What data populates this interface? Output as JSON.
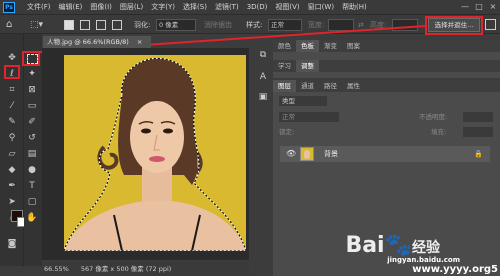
{
  "menubar": {
    "logo": "Ps",
    "items": [
      "文件(F)",
      "编辑(E)",
      "图像(I)",
      "图层(L)",
      "文字(Y)",
      "选择(S)",
      "滤镜(T)",
      "3D(D)",
      "视图(V)",
      "窗口(W)",
      "帮助(H)"
    ],
    "window_controls": [
      "—",
      "□",
      "×"
    ]
  },
  "options": {
    "feather_label": "羽化:",
    "feather_value": "0 像素",
    "antialias_label": "消除锯齿",
    "style_label": "样式:",
    "style_value": "正常",
    "width_label": "宽度:",
    "height_label": "高度:",
    "select_mask_label": "选择并遮住..."
  },
  "document": {
    "tab_title": "人物.jpg @ 66.6%(RGB/8)",
    "close": "×",
    "zoom": "66.55%",
    "size": "567 像素 x 500 像素 (72 ppi)"
  },
  "panels": {
    "top_tabs": [
      "颜色",
      "色板",
      "渐变",
      "图案"
    ],
    "mid_tabs": [
      "学习",
      "调整"
    ],
    "layer_tabs": [
      "图层",
      "通道",
      "路径",
      "属性"
    ],
    "kind_label": "类型",
    "blend_mode": "正常",
    "opacity_label": "不透明度:",
    "lock_label": "锁定:",
    "fill_label": "填充:"
  },
  "layers": [
    {
      "name": "背景"
    }
  ],
  "watermark": {
    "line1": "Bai",
    "line2": "经验",
    "line3": "jingyan.baidu.com",
    "line4": "www.yyyy.org5"
  },
  "colors": {
    "highlight": "#e1232b",
    "background_photo": "#d9b930"
  }
}
